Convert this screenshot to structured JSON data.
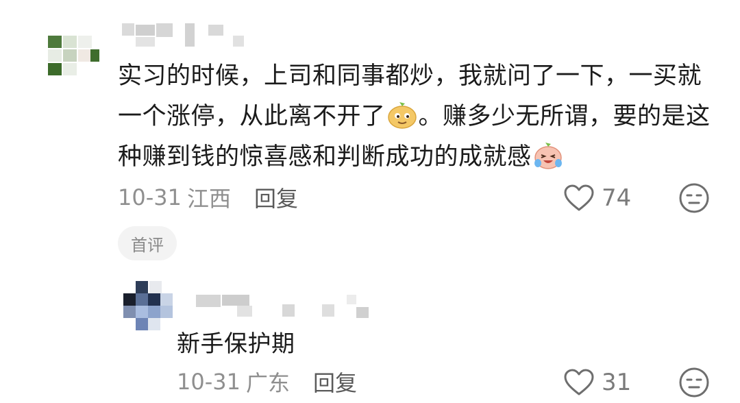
{
  "comments": [
    {
      "text_part1": "实习的时候，上司和同事都炒，我就问了一下，一买就一个涨停，从此离不开了",
      "emoji1": "smug-face-emoji",
      "text_part2": "。赚多少无所谓，要的是这种赚到钱的惊喜感和判断成功的成就感",
      "emoji2": "crying-laughing-emoji",
      "date": "10-31",
      "location": "江西",
      "reply_label": "回复",
      "likes": "74",
      "badge": "首评"
    },
    {
      "text": "新手保护期",
      "date": "10-31",
      "location": "广东",
      "reply_label": "回复",
      "likes": "31"
    }
  ],
  "colors": {
    "text": "#1b1b1b",
    "meta": "#8f8f8f",
    "icon": "#6e6e6e",
    "badge_bg": "#f3f3f3"
  }
}
